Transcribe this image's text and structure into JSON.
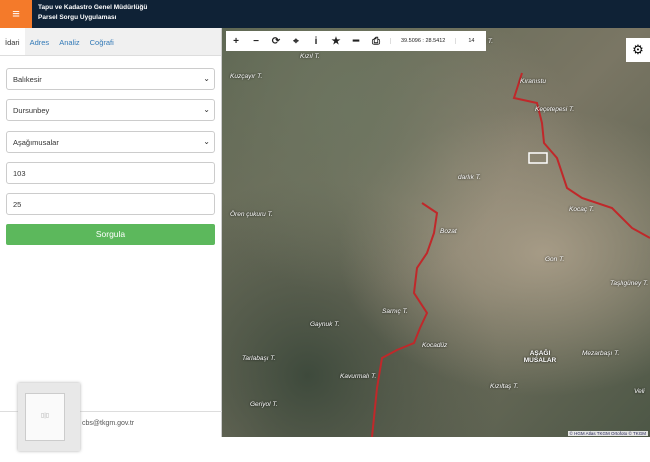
{
  "header": {
    "title_line1": "Tapu ve Kadastro Genel Müdürlüğü",
    "title_line2": "Parsel Sorgu Uygulaması",
    "menu_icon": "hamburger-icon",
    "brand_color": "#f47a2a"
  },
  "tabs": [
    {
      "label": "İdari"
    },
    {
      "label": "Adres"
    },
    {
      "label": "Analiz"
    },
    {
      "label": "Coğrafi"
    }
  ],
  "form": {
    "il": "Balıkesir",
    "ilce": "Dursunbey",
    "mahalle": "Aşağımusalar",
    "ada": "103",
    "parsel": "25",
    "query_label": "Sorgula",
    "query_color": "#5cb85c"
  },
  "footer": {
    "email": "cbs@tkgm.gov.tr"
  },
  "map": {
    "coords": "39.5096 : 28.5412",
    "zoom": "14",
    "attribution": "© HGM Atlas  TKGM Ortofoto © TKGM",
    "places": [
      "Kızıl T.",
      "İkelemeç T.",
      "Kuzçayır T.",
      "Kıranıstu",
      "Keçetepesi T.",
      "darlık T.",
      "Ören çukuru T.",
      "Bozat",
      "Kocaç T.",
      "Gon T.",
      "Taşlıgüney T.",
      "Gaynuk T.",
      "Sarnıç T.",
      "Kocadüz",
      "Tarlabaşı T.",
      "AŞAĞI MUSALAR",
      "Mezarbaşı T.",
      "Kavurmalı T.",
      "Kızıltaş T.",
      "Geriyol T.",
      "Veli"
    ]
  }
}
